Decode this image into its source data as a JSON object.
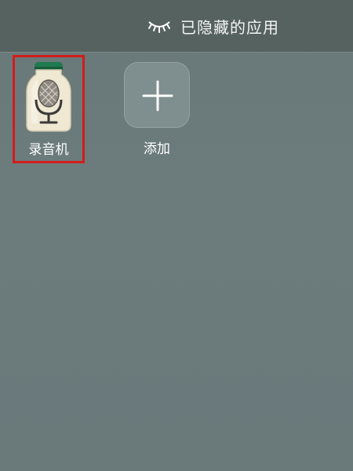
{
  "header": {
    "icon": "eye-closed-icon",
    "title": "已隐藏的应用"
  },
  "apps": [
    {
      "label": "录音机",
      "icon": "voice-recorder-icon",
      "selected": true,
      "selection_color": "#d31c1c"
    }
  ],
  "add": {
    "label": "添加",
    "icon": "plus-icon"
  },
  "colors": {
    "background": "#6b7b7c",
    "header_background": "#56625f",
    "text": "#ffffff"
  }
}
